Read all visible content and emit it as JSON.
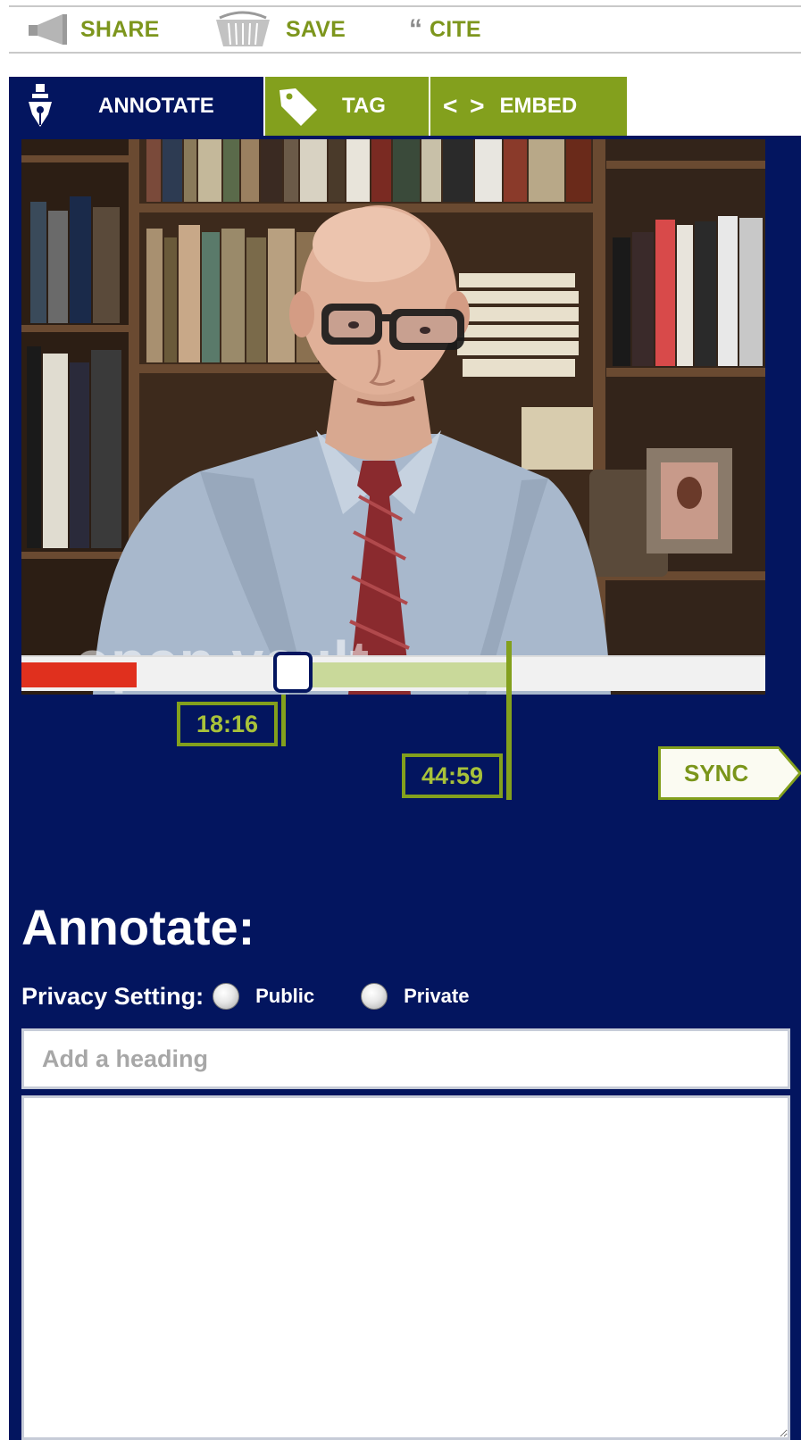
{
  "toolbar": {
    "share_label": "SHARE",
    "save_label": "SAVE",
    "cite_icon": "“",
    "cite_label": "CITE"
  },
  "tabs": [
    {
      "label": "ANNOTATE",
      "icon": "pen-nib-icon",
      "active": true
    },
    {
      "label": "TAG",
      "icon": "tag-icon",
      "active": false
    },
    {
      "label": "EMBED",
      "icon": "code-brackets-icon",
      "glyph": "< >",
      "active": false
    }
  ],
  "video": {
    "watermark": "open vault",
    "played_fraction": 0.155,
    "range_start_time": "18:16",
    "range_end_time": "44:59",
    "range_start_fraction": 0.365,
    "range_end_fraction": 0.655
  },
  "sync_label": "SYNC",
  "form": {
    "title": "Annotate:",
    "privacy_label": "Privacy Setting:",
    "options": [
      "Public",
      "Private"
    ],
    "heading_placeholder": "Add a heading",
    "body_value": ""
  },
  "colors": {
    "navy": "#03155f",
    "green": "#83a01d",
    "red": "#e0301e"
  }
}
